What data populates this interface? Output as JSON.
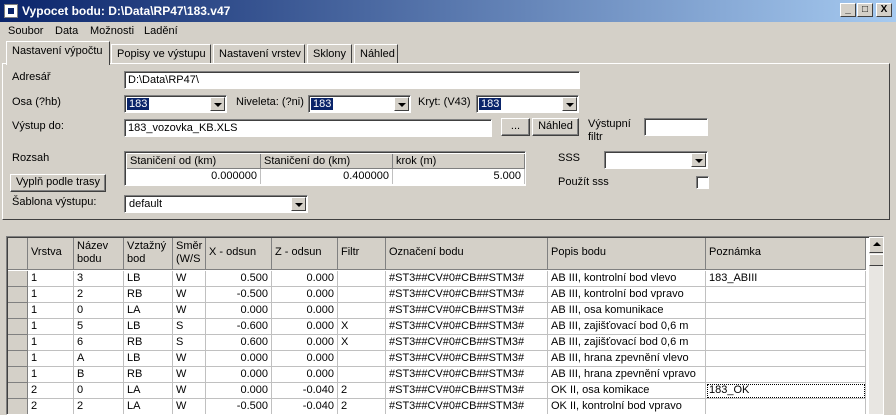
{
  "window": {
    "title": "Vypocet bodu: D:\\Data\\RP47\\183.v47",
    "minimize": "_",
    "maximize": "□",
    "close": "X"
  },
  "menu": [
    "Soubor",
    "Data",
    "Možnosti",
    "Ladění"
  ],
  "tabs": [
    "Nastavení výpočtu",
    "Popisy ve výstupu",
    "Nastavení vrstev",
    "Sklony",
    "Náhled"
  ],
  "form": {
    "adresar_label": "Adresář",
    "adresar_value": "D:\\Data\\RP47\\",
    "osa_label": "Osa (?hb)",
    "osa_value": "183",
    "niveleta_label": "Niveleta: (?ni)",
    "niveleta_value": "183",
    "kryt_label": "Kryt: (V43)",
    "kryt_value": "183",
    "vystup_label": "Výstup do:",
    "vystup_value": "183_vozovka_KB.XLS",
    "browse_button": "...",
    "nahled_button": "Náhled",
    "vystupni_filtr_label": "Výstupní filtr",
    "vystupni_filtr_value": "",
    "rozsah_label": "Rozsah",
    "vyplnit_button": "Vyplň podle trasy",
    "sablona_label": "Šablona výstupu:",
    "sablona_value": "default",
    "sss_label": "SSS",
    "sss_value": "",
    "pouzit_sss_label": "Použít sss",
    "pouzit_sss_checked": false
  },
  "range": {
    "headers": [
      "Staničení od (km)",
      "Staničení do (km)",
      "krok (m)"
    ],
    "values": [
      "0.000000",
      "0.400000",
      "5.000"
    ]
  },
  "grid": {
    "headers": [
      "Vrstva",
      "Název bodu",
      "Vztažný bod",
      "Směr (W/S",
      "X - odsun",
      "Z - odsun",
      "Filtr",
      "Označení bodu",
      "Popis bodu",
      "Poznámka"
    ],
    "rows": [
      [
        "1",
        "3",
        "LB",
        "W",
        "0.500",
        "0.000",
        "",
        "#ST3##CV#0#CB##STM3#",
        "AB III, kontrolní bod vlevo",
        "183_ABIII"
      ],
      [
        "1",
        "2",
        "RB",
        "W",
        "-0.500",
        "0.000",
        "",
        "#ST3##CV#0#CB##STM3#",
        "AB III, kontrolní bod vpravo",
        ""
      ],
      [
        "1",
        "0",
        "LA",
        "W",
        "0.000",
        "0.000",
        "",
        "#ST3##CV#0#CB##STM3#",
        "AB III, osa komunikace",
        ""
      ],
      [
        "1",
        "5",
        "LB",
        "S",
        "-0.600",
        "0.000",
        "X",
        "#ST3##CV#0#CB##STM3#",
        "AB III, zajišťovací bod 0,6 m",
        ""
      ],
      [
        "1",
        "6",
        "RB",
        "S",
        "0.600",
        "0.000",
        "X",
        "#ST3##CV#0#CB##STM3#",
        "AB III, zajišťovací bod 0,6 m",
        ""
      ],
      [
        "1",
        "A",
        "LB",
        "W",
        "0.000",
        "0.000",
        "",
        "#ST3##CV#0#CB##STM3#",
        "AB III, hrana zpevnění vlevo",
        ""
      ],
      [
        "1",
        "B",
        "RB",
        "W",
        "0.000",
        "0.000",
        "",
        "#ST3##CV#0#CB##STM3#",
        "AB III, hrana zpevnění vpravo",
        ""
      ],
      [
        "2",
        "0",
        "LA",
        "W",
        "0.000",
        "-0.040",
        "2",
        "#ST3##CV#0#CB##STM3#",
        "OK II, osa komikace",
        "183_OK"
      ],
      [
        "2",
        "2",
        "LA",
        "W",
        "-0.500",
        "-0.040",
        "2",
        "#ST3##CV#0#CB##STM3#",
        "OK II, kontrolní bod vpravo",
        ""
      ]
    ]
  }
}
